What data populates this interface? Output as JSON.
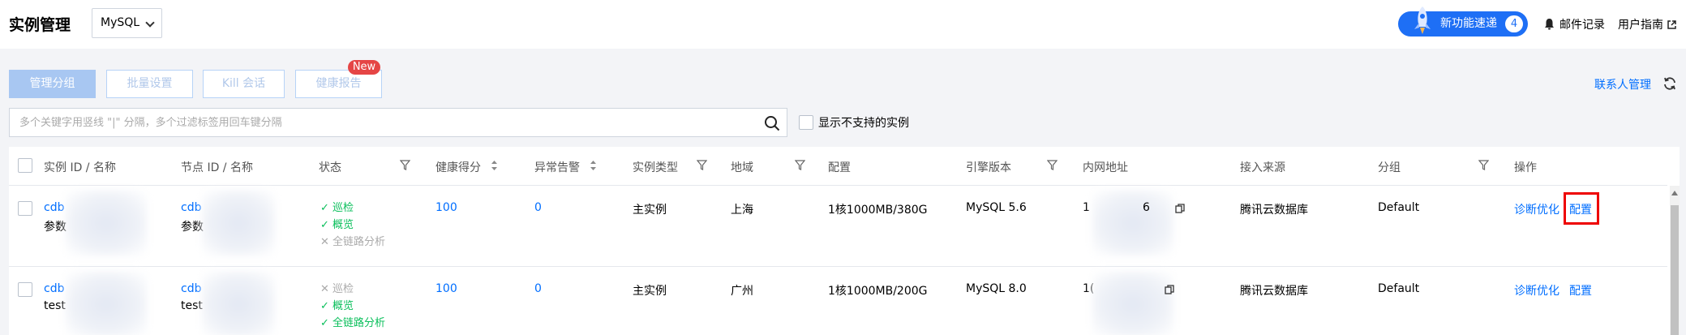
{
  "header": {
    "title": "实例管理",
    "db_select": "MySQL",
    "new_feature_label": "新功能速递",
    "new_feature_count": "4",
    "mail_log": "邮件记录",
    "user_guide": "用户指南"
  },
  "toolbar": {
    "manage_group": "管理分组",
    "batch_settings": "批量设置",
    "kill_session": "Kill 会话",
    "health_report": "健康报告",
    "new_badge": "New",
    "contact_manage": "联系人管理"
  },
  "search": {
    "placeholder": "多个关键字用竖线 \"|\" 分隔，多个过滤标签用回车键分隔",
    "show_unsupported": "显示不支持的实例"
  },
  "table": {
    "columns": {
      "instance": "实例 ID / 名称",
      "node": "节点 ID / 名称",
      "status": "状态",
      "health": "健康得分",
      "alarm": "异常告警",
      "type": "实例类型",
      "region": "地域",
      "config": "配置",
      "engine": "引擎版本",
      "ip": "内网地址",
      "source": "接入来源",
      "group": "分组",
      "ops": "操作"
    },
    "rows": [
      {
        "instance_id": "cdb",
        "instance_name": "参数",
        "node_id": "cdb",
        "node_name": "参数",
        "status_1": "巡检",
        "status_2": "概览",
        "status_3": "全链路分析",
        "health": "100",
        "alarm": "0",
        "type": "主实例",
        "region": "上海",
        "config": "1核1000MB/380G",
        "engine": "MySQL 5.6",
        "ip_start": "1",
        "ip_end": "6",
        "source": "腾讯云数据库",
        "group": "Default",
        "op_diagnose": "诊断优化",
        "op_config": "配置"
      },
      {
        "instance_id": "cdb",
        "instance_name": "test",
        "node_id": "cdb",
        "node_name": "test",
        "status_1": "巡检",
        "status_2": "概览",
        "status_3": "全链路分析",
        "health": "100",
        "alarm": "0",
        "type": "主实例",
        "region": "广州",
        "config": "1核1000MB/200G",
        "engine": "MySQL 8.0",
        "ip_start": "1(",
        "ip_end": "",
        "source": "腾讯云数据库",
        "group": "Default",
        "op_diagnose": "诊断优化",
        "op_config": "配置"
      }
    ]
  },
  "colors": {
    "primary": "#006eff",
    "success": "#0abf5b",
    "danger": "#e54545",
    "highlight": "#e00000"
  }
}
